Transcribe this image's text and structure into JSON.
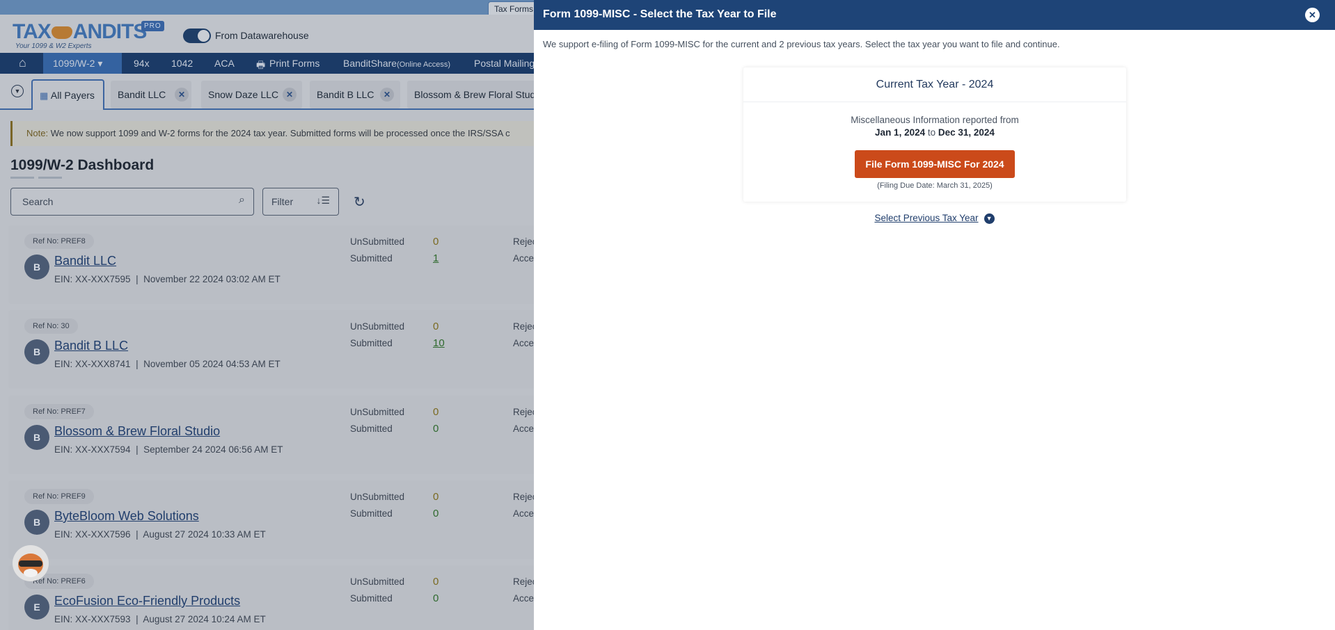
{
  "app": {
    "tab_label": "Tax Forms",
    "logo_text": "TAXBANDITS",
    "tagline": "Your 1099 & W2 Experts",
    "pro_badge": "PRO",
    "toggle_label": "From Datawarehouse"
  },
  "nav": {
    "items": [
      {
        "label": "1099/W-2 ▾"
      },
      {
        "label": "94x"
      },
      {
        "label": "1042"
      },
      {
        "label": "ACA"
      },
      {
        "label": "Print Forms"
      },
      {
        "label": "BanditShare"
      },
      {
        "label": "Postal Mailing"
      }
    ],
    "bandit_sub": "(Online Access)"
  },
  "payer_tabs": {
    "all": "All Payers",
    "items": [
      "Bandit LLC",
      "Snow Daze LLC",
      "Bandit B LLC",
      "Blossom & Brew Floral Studio"
    ]
  },
  "note": {
    "prefix": "Note:",
    "text": " We now support 1099 and W-2 forms for the 2024 tax year. Submitted forms will be processed once the IRS/SSA c"
  },
  "dashboard": {
    "title": "1099/W-2 Dashboard",
    "search_placeholder": "Search",
    "filter_label": "Filter",
    "labels": {
      "unsubmitted": "UnSubmitted",
      "submitted": "Submitted",
      "rejected": "Rejec",
      "accepted": "Acce"
    },
    "payers": [
      {
        "ref": "Ref No: PREF8",
        "initial": "B",
        "name": "Bandit LLC",
        "ein": "EIN: XX-XXX7595",
        "date": "November 22 2024 03:02 AM ET",
        "unsubmitted": "0",
        "submitted": "1"
      },
      {
        "ref": "Ref No: 30",
        "initial": "B",
        "name": "Bandit B LLC",
        "ein": "EIN: XX-XXX8741",
        "date": "November 05 2024 04:53 AM ET",
        "unsubmitted": "0",
        "submitted": "10"
      },
      {
        "ref": "Ref No: PREF7",
        "initial": "B",
        "name": "Blossom & Brew Floral Studio",
        "ein": "EIN: XX-XXX7594",
        "date": "September 24 2024 06:56 AM ET",
        "unsubmitted": "0",
        "submitted": "0"
      },
      {
        "ref": "Ref No: PREF9",
        "initial": "B",
        "name": "ByteBloom Web Solutions",
        "ein": "EIN: XX-XXX7596",
        "date": "August 27 2024 10:33 AM ET",
        "unsubmitted": "0",
        "submitted": "0"
      },
      {
        "ref": "Ref No: PREF6",
        "initial": "E",
        "name": "EcoFusion Eco-Friendly Products",
        "ein": "EIN: XX-XXX7593",
        "date": "August 27 2024 10:24 AM ET",
        "unsubmitted": "0",
        "submitted": "0"
      }
    ]
  },
  "dialog": {
    "title": "Form 1099-MISC - Select the Tax Year to File",
    "description": "We support e-filing of Form 1099-MISC for the current and 2 previous tax years. Select the tax year you want to file and continue.",
    "card_title": "Current Tax Year - 2024",
    "reported_from": "Miscellaneous Information reported from",
    "date_from": "Jan 1, 2024",
    "to": " to ",
    "date_to": "Dec 31, 2024",
    "file_button": "File Form 1099-MISC For 2024",
    "due_date": "(Filing Due Date: March 31, 2025)",
    "previous_link": "Select Previous Tax Year"
  },
  "colors": {
    "header": "#1e4477",
    "file_button": "#cb4a1a"
  }
}
